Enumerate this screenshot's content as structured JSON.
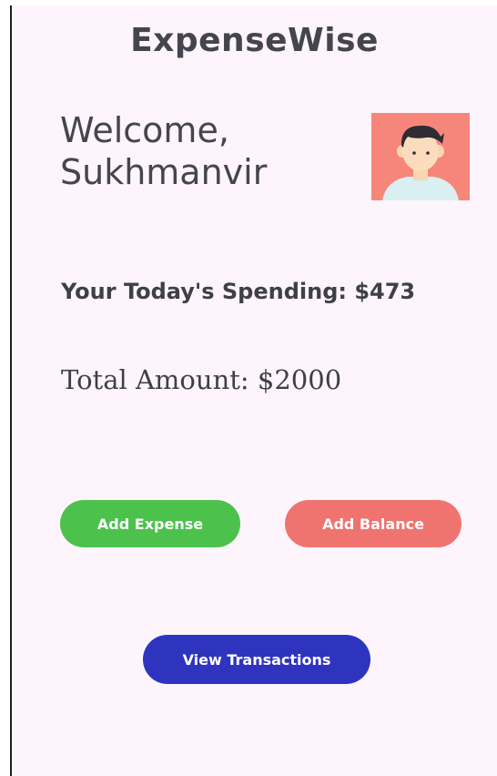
{
  "app": {
    "title": "ExpenseWise"
  },
  "header": {
    "welcome_line1": "Welcome,",
    "welcome_line2": "Sukhmanvir",
    "avatar_icon": "user-avatar-icon"
  },
  "summary": {
    "spending_text": "Your Today's Spending: $473",
    "total_text": "Total Amount: $2000"
  },
  "actions": {
    "add_expense_label": "Add Expense",
    "add_balance_label": "Add Balance",
    "view_transactions_label": "View Transactions"
  },
  "colors": {
    "background": "#fdf5fb",
    "add_expense": "#4cc24c",
    "add_balance": "#ef7470",
    "view_transactions": "#2f34bf",
    "avatar_background": "#f7867a"
  }
}
